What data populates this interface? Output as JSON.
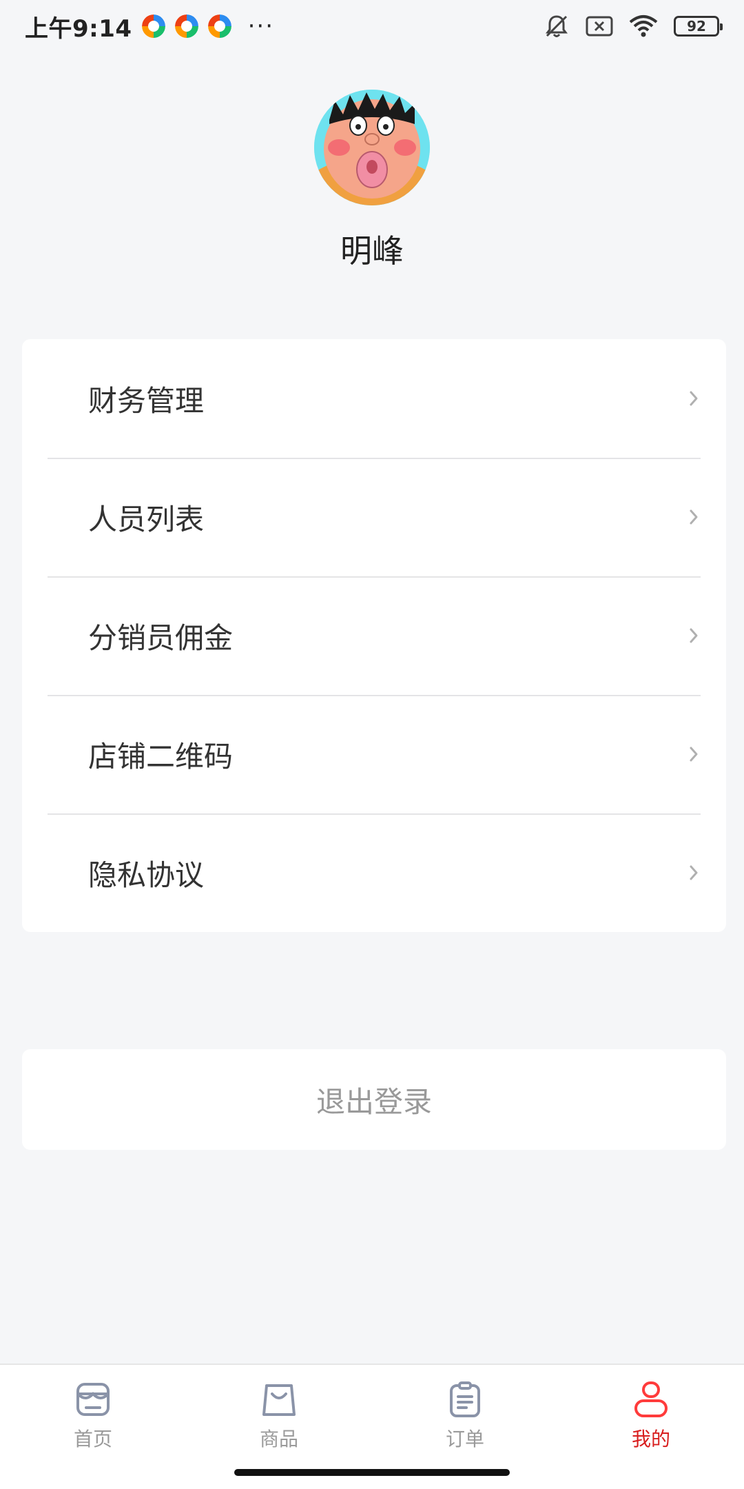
{
  "status_bar": {
    "time": "上午9:14",
    "more": "···",
    "battery": "92"
  },
  "profile": {
    "name": "明峰"
  },
  "menu": {
    "items": [
      {
        "label": "财务管理"
      },
      {
        "label": "人员列表"
      },
      {
        "label": "分销员佣金"
      },
      {
        "label": "店铺二维码"
      },
      {
        "label": "隐私协议"
      }
    ]
  },
  "logout": {
    "label": "退出登录"
  },
  "tabbar": {
    "tabs": [
      {
        "label": "首页",
        "icon": "store-icon"
      },
      {
        "label": "商品",
        "icon": "shopping-bag-icon"
      },
      {
        "label": "订单",
        "icon": "clipboard-icon"
      },
      {
        "label": "我的",
        "icon": "user-icon"
      }
    ],
    "active_index": 3
  },
  "colors": {
    "accent": "#d81e1e",
    "background": "#f5f6f8",
    "card": "#ffffff"
  }
}
